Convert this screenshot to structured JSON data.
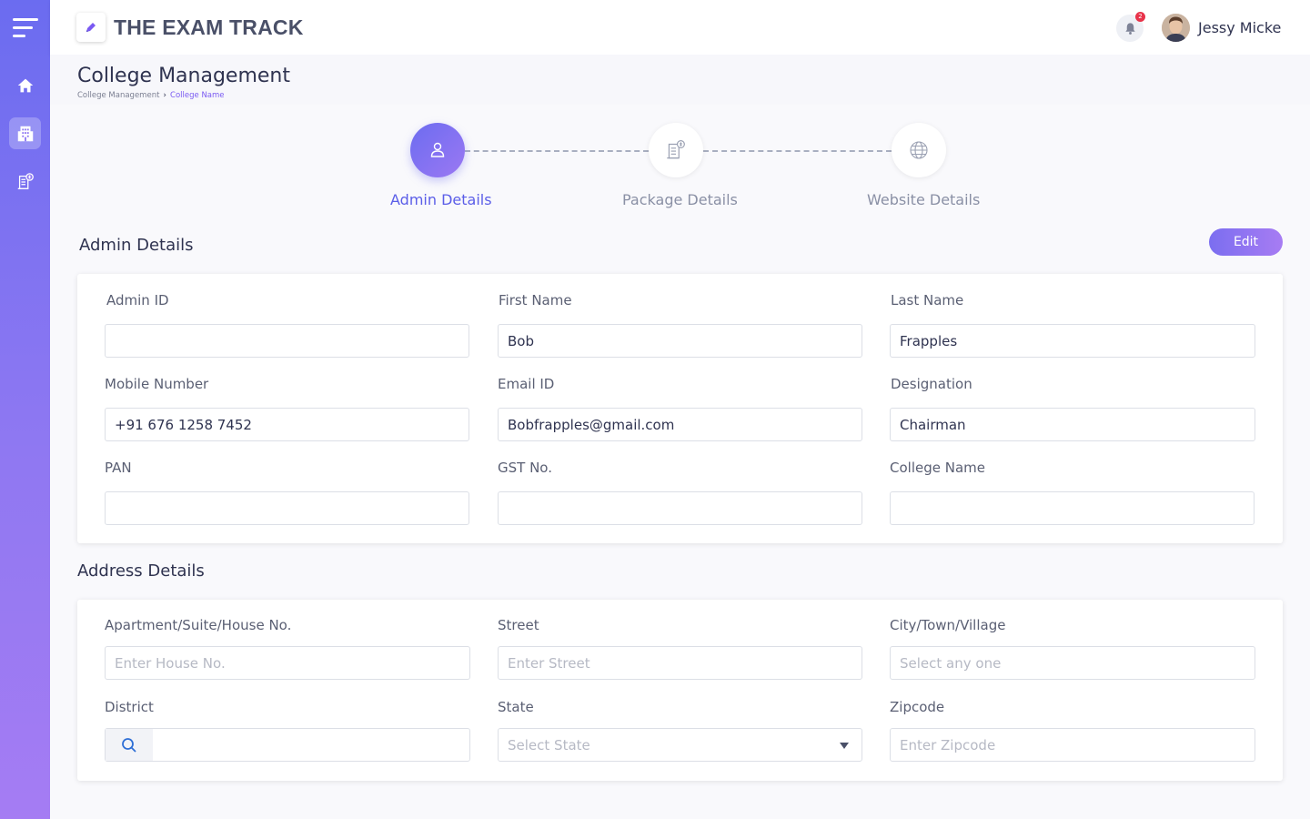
{
  "app": {
    "title": "THE EXAM TRACK",
    "accent": "#6c6cf0",
    "accent_secondary": "#a77cf3"
  },
  "sidebar": {
    "items": [
      {
        "icon": "home-icon",
        "active": false
      },
      {
        "icon": "building-icon",
        "active": true
      },
      {
        "icon": "invoice-icon",
        "active": false
      }
    ]
  },
  "topbar": {
    "notification_count": "2",
    "user_name": "Jessy Micke"
  },
  "header": {
    "title": "College Management",
    "breadcrumb": [
      "College Management",
      "College Name"
    ]
  },
  "stepper": {
    "steps": [
      {
        "label": "Admin Details",
        "icon": "user-icon",
        "active": true
      },
      {
        "label": "Package Details",
        "icon": "invoice-icon",
        "active": false
      },
      {
        "label": "Website Details",
        "icon": "globe-icon",
        "active": false
      }
    ]
  },
  "admin": {
    "section_title": "Admin Details",
    "edit_label": "Edit",
    "fields": {
      "admin_id": {
        "label": "Admin ID",
        "value": ""
      },
      "first_name": {
        "label": "First Name",
        "value": "Bob"
      },
      "last_name": {
        "label": "Last Name",
        "value": "Frapples"
      },
      "mobile": {
        "label": "Mobile Number",
        "value": "+91 676 1258 7452"
      },
      "email": {
        "label": "Email ID",
        "value": "Bobfrapples@gmail.com"
      },
      "designation": {
        "label": "Designation",
        "value": "Chairman"
      },
      "pan": {
        "label": "PAN",
        "value": ""
      },
      "gst": {
        "label": "GST No.",
        "value": ""
      },
      "college_name": {
        "label": "College Name",
        "value": ""
      }
    }
  },
  "address": {
    "section_title": "Address Details",
    "fields": {
      "house": {
        "label": "Apartment/Suite/House No.",
        "placeholder": "Enter House No."
      },
      "street": {
        "label": "Street",
        "placeholder": "Enter Street"
      },
      "city": {
        "label": "City/Town/Village",
        "placeholder": "Select any one"
      },
      "district": {
        "label": "District",
        "placeholder": ""
      },
      "state": {
        "label": "State",
        "placeholder": "Select State"
      },
      "zipcode": {
        "label": "Zipcode",
        "placeholder": "Enter Zipcode"
      }
    }
  }
}
